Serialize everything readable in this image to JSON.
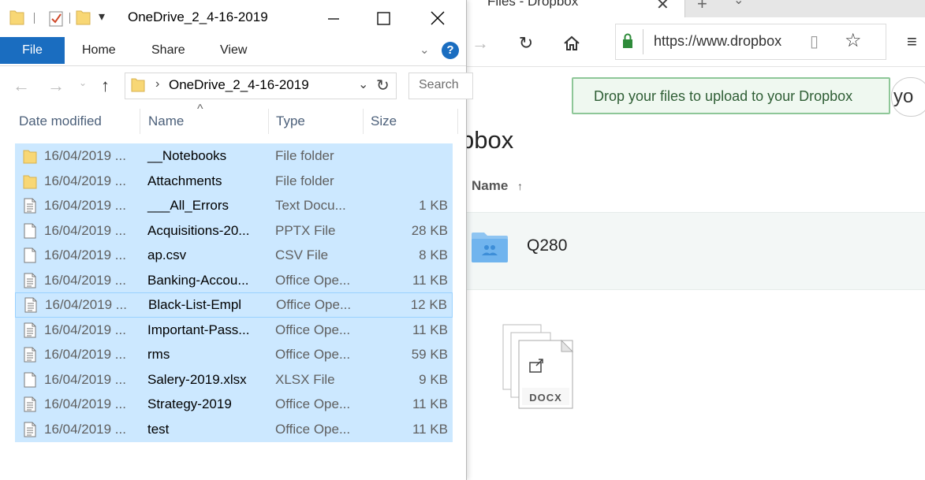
{
  "browser": {
    "tab_title": "Files - Dropbox",
    "url": "https://www.dropbox",
    "toast": "Drop your files to upload to your Dropbox",
    "avatar_initials": "yo",
    "page_title": "pbox",
    "sort_label": "Name",
    "folder_name": "Q280",
    "drag_badge": "DOCX"
  },
  "explorer": {
    "window_title": "OneDrive_2_4-16-2019",
    "ribbon_tabs": [
      "File",
      "Home",
      "Share",
      "View"
    ],
    "address_path": "OneDrive_2_4-16-2019",
    "search_placeholder": "Search",
    "columns": [
      "Date modified",
      "Name",
      "Type",
      "Size"
    ],
    "files": [
      {
        "date": "16/04/2019 ...",
        "name": "__Notebooks",
        "type": "File folder",
        "size": "",
        "icon": "folder-icon"
      },
      {
        "date": "16/04/2019 ...",
        "name": "Attachments",
        "type": "File folder",
        "size": "",
        "icon": "folder-icon"
      },
      {
        "date": "16/04/2019 ...",
        "name": "___All_Errors",
        "type": "Text Docu...",
        "size": "1 KB",
        "icon": "text-document-icon"
      },
      {
        "date": "16/04/2019 ...",
        "name": "Acquisitions-20...",
        "type": "PPTX File",
        "size": "28 KB",
        "icon": "blank-file-icon"
      },
      {
        "date": "16/04/2019 ...",
        "name": "ap.csv",
        "type": "CSV File",
        "size": "8 KB",
        "icon": "blank-file-icon"
      },
      {
        "date": "16/04/2019 ...",
        "name": "Banking-Accou...",
        "type": "Office Ope...",
        "size": "11 KB",
        "icon": "text-document-icon"
      },
      {
        "date": "16/04/2019 ...",
        "name": "Black-List-Empl",
        "type": "Office Ope...",
        "size": "12 KB",
        "icon": "text-document-icon"
      },
      {
        "date": "16/04/2019 ...",
        "name": "Important-Pass...",
        "type": "Office Ope...",
        "size": "11 KB",
        "icon": "text-document-icon"
      },
      {
        "date": "16/04/2019 ...",
        "name": "rms",
        "type": "Office Ope...",
        "size": "59 KB",
        "icon": "text-document-icon"
      },
      {
        "date": "16/04/2019 ...",
        "name": "Salery-2019.xlsx",
        "type": "XLSX File",
        "size": "9 KB",
        "icon": "blank-file-icon"
      },
      {
        "date": "16/04/2019 ...",
        "name": "Strategy-2019",
        "type": "Office Ope...",
        "size": "11 KB",
        "icon": "text-document-icon"
      },
      {
        "date": "16/04/2019 ...",
        "name": "test",
        "type": "Office Ope...",
        "size": "11 KB",
        "icon": "text-document-icon"
      }
    ]
  },
  "colors": {
    "selection": "#cce8ff",
    "selection_border": "#99d1ff",
    "file_tab": "#1a6dc0",
    "toast_border": "#8ec798",
    "folder_yellow": "#f8d775"
  }
}
